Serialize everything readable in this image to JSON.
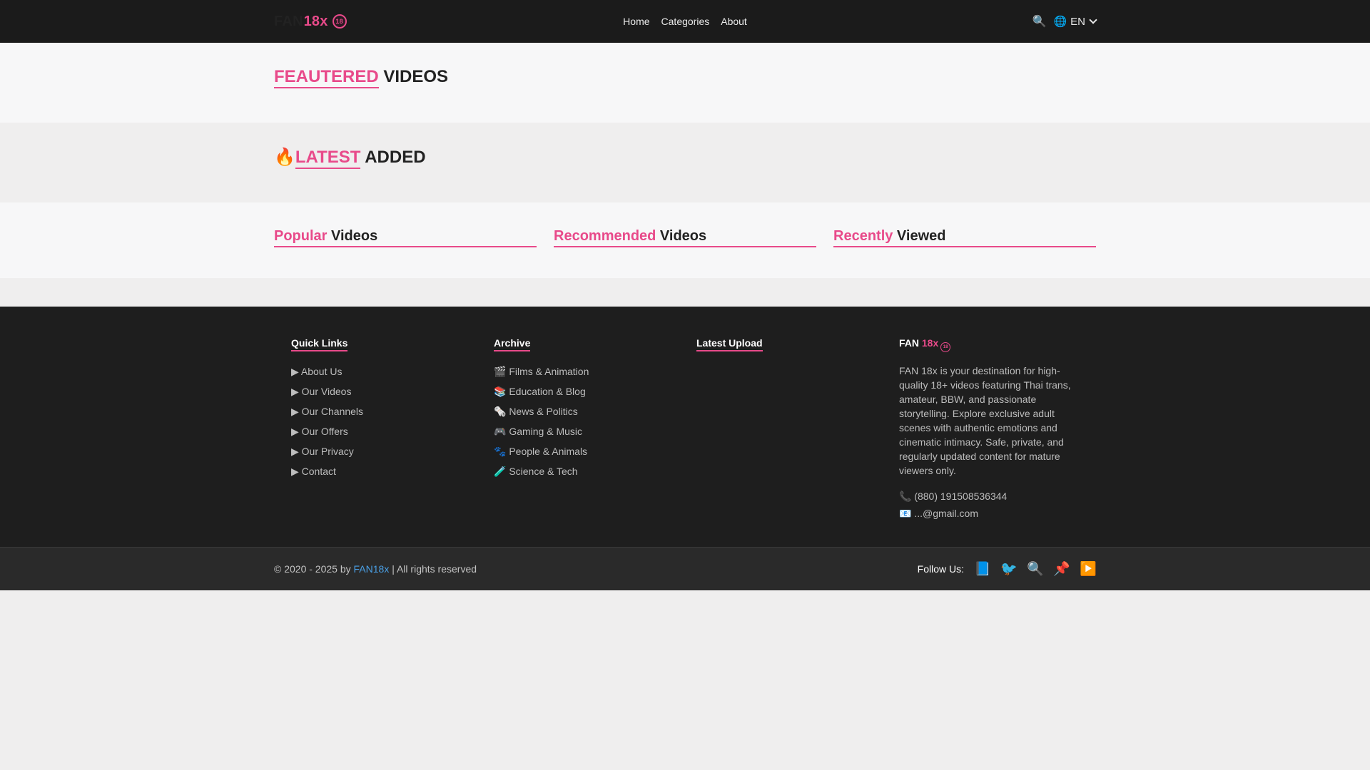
{
  "header": {
    "logo_fan": "FAN",
    "logo_18x": "18x",
    "logo_badge": "18",
    "nav": [
      "Home",
      "Categories",
      "About"
    ],
    "search_glyph": "🔍",
    "lang_glyph": "🌐",
    "lang_label": "EN"
  },
  "featured": {
    "accent": "FEAUTERED",
    "rest": " VIDEOS"
  },
  "latest": {
    "fire": "🔥",
    "accent": "LATEST",
    "rest": " ADDED"
  },
  "columns": [
    {
      "accent": "Popular",
      "rest": " Videos"
    },
    {
      "accent": "Recommended",
      "rest": " Videos"
    },
    {
      "accent": "Recently",
      "rest": " Viewed"
    }
  ],
  "footer": {
    "quick_links": {
      "title": "Quick Links",
      "items": [
        "▶ About Us",
        "▶ Our Videos",
        "▶ Our Channels",
        "▶ Our Offers",
        "▶ Our Privacy",
        "▶ Contact"
      ]
    },
    "archive": {
      "title": "Archive",
      "items": [
        "🎬 Films & Animation",
        "📚 Education & Blog",
        "🗞️ News & Politics",
        "🎮 Gaming & Music",
        "🐾 People & Animals",
        "🧪 Science & Tech"
      ]
    },
    "latest_upload": {
      "title": "Latest Upload"
    },
    "about": {
      "title_fan": "FAN ",
      "title_18x": "18x",
      "badge": "18",
      "text": "FAN 18x is your destination for high-quality 18+ videos featuring Thai trans, amateur, BBW, and passionate storytelling. Explore exclusive adult scenes with authentic emotions and cinematic intimacy. Safe, private, and regularly updated content for mature viewers only.",
      "phone": "📞 (880) 191508536344",
      "email": "📧 ...@gmail.com"
    }
  },
  "bottom": {
    "copy_pre": "© 2020 - 2025 by ",
    "copy_brand": "FAN18x",
    "copy_post": " | All rights reserved",
    "follow_label": "Follow Us:",
    "social": [
      "📘",
      "🐦",
      "🔍",
      "📌",
      "▶️"
    ]
  },
  "colors": {
    "accent": "#e84a8a",
    "header_bg": "#1b1b1b",
    "footer_bg": "#1e1e1e",
    "link_blue": "#4aa0e6"
  }
}
